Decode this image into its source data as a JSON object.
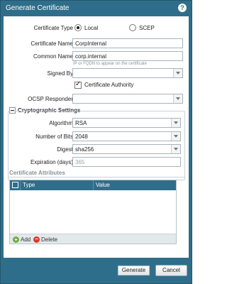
{
  "dialog": {
    "title": "Generate Certificate",
    "help_glyph": "?"
  },
  "form": {
    "certificate_type_label": "Certificate Type",
    "type_options": [
      "Local",
      "SCEP"
    ],
    "type_selected": "Local",
    "certificate_name_label": "Certificate Name",
    "certificate_name_value": "CorpInternal",
    "common_name_label": "Common Name",
    "common_name_value": "corp.internal",
    "common_name_hint": "IP or FQDN to appear on the certificate",
    "signed_by_label": "Signed By",
    "signed_by_value": "",
    "certificate_authority_label": "Certificate Authority",
    "certificate_authority_checked": true,
    "ocsp_responder_label": "OCSP Responder",
    "ocsp_responder_value": ""
  },
  "crypto": {
    "section_title": "Cryptographic Settings",
    "algorithm_label": "Algorithm",
    "algorithm_value": "RSA",
    "bits_label": "Number of Bits",
    "bits_value": "2048",
    "digest_label": "Digest",
    "digest_value": "sha256",
    "expiration_label": "Expiration (days)",
    "expiration_value": "365"
  },
  "attributes": {
    "section_title": "Certificate Attributes",
    "columns": [
      "Type",
      "Value"
    ],
    "rows": [],
    "add_label": "Add",
    "delete_label": "Delete"
  },
  "buttons": {
    "generate_label": "Generate",
    "cancel_label": "Cancel"
  },
  "colors": {
    "accent": "#2f6e8a",
    "add": "#6bad3b",
    "delete": "#d53d2f"
  }
}
